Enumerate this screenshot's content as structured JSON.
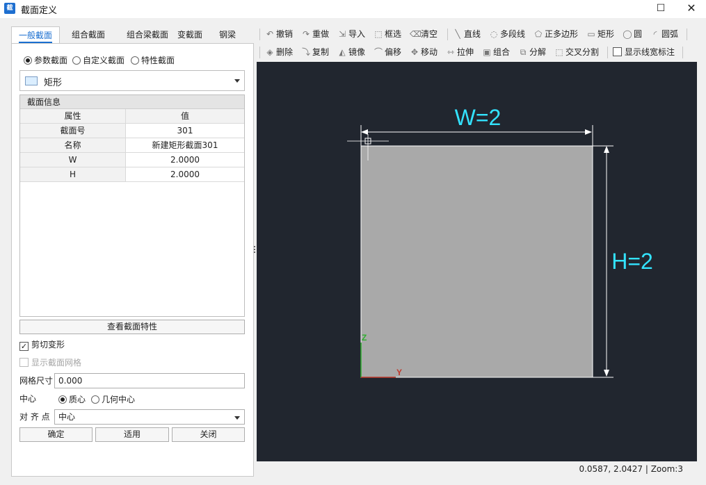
{
  "window": {
    "title": "截面定义",
    "max_glyph": "☐",
    "close_glyph": "✕",
    "app_icon_text": "截"
  },
  "tabs": [
    {
      "label": "一般截面",
      "active": true
    },
    {
      "label": "组合截面"
    },
    {
      "label": "组合梁截面"
    },
    {
      "label": "变截面"
    },
    {
      "label": "钢梁"
    }
  ],
  "section_type": {
    "options": [
      "参数截面",
      "自定义截面",
      "特性截面"
    ],
    "selected": "参数截面"
  },
  "shape": {
    "label": "矩形"
  },
  "section_info": {
    "title": "截面信息",
    "columns": [
      "属性",
      "值"
    ],
    "rows": [
      {
        "name": "截面号",
        "value": "301"
      },
      {
        "name": "名称",
        "value": "新建矩形截面301"
      },
      {
        "name": "W",
        "value": "2.0000"
      },
      {
        "name": "H",
        "value": "2.0000"
      }
    ]
  },
  "view_props_button": "查看截面特性",
  "shear_deform": {
    "label": "剪切变形",
    "checked": true
  },
  "show_mesh": {
    "label": "显示截面网格",
    "checked": false,
    "enabled": false
  },
  "mesh_size": {
    "label": "网格尺寸",
    "value": "0.000"
  },
  "center": {
    "label": "中心",
    "options": [
      "质心",
      "几何中心"
    ],
    "selected": "质心"
  },
  "align_point": {
    "label": "对 齐 点",
    "value": "中心"
  },
  "buttons": {
    "ok": "确定",
    "apply": "适用",
    "close": "关闭"
  },
  "toolbar": {
    "row1": [
      {
        "label": "撤销",
        "icon": "undo-icon",
        "glyph": "↶"
      },
      {
        "label": "重做",
        "icon": "redo-icon",
        "glyph": "↷"
      },
      {
        "label": "导入",
        "icon": "import-icon",
        "glyph": "⇲"
      },
      {
        "label": "框选",
        "icon": "box-select-icon",
        "glyph": "⬚"
      },
      {
        "label": "清空",
        "icon": "clear-icon",
        "glyph": "⌫"
      },
      {
        "label": "直线",
        "icon": "line-icon",
        "glyph": "╲"
      },
      {
        "label": "多段线",
        "icon": "polyline-icon",
        "glyph": "◌"
      },
      {
        "label": "正多边形",
        "icon": "polygon-icon",
        "glyph": "⬠"
      },
      {
        "label": "矩形",
        "icon": "rectangle-icon",
        "glyph": "▭"
      },
      {
        "label": "圆",
        "icon": "circle-icon",
        "glyph": "◯"
      },
      {
        "label": "圆弧",
        "icon": "arc-icon",
        "glyph": "◜"
      }
    ],
    "row2": [
      {
        "label": "删除",
        "icon": "delete-icon",
        "glyph": "◈"
      },
      {
        "label": "复制",
        "icon": "copy-icon",
        "glyph": "⤵"
      },
      {
        "label": "镜像",
        "icon": "mirror-icon",
        "glyph": "◭"
      },
      {
        "label": "偏移",
        "icon": "offset-icon",
        "glyph": "⌒"
      },
      {
        "label": "移动",
        "icon": "move-icon",
        "glyph": "✥"
      },
      {
        "label": "拉伸",
        "icon": "stretch-icon",
        "glyph": "⇿"
      },
      {
        "label": "组合",
        "icon": "group-icon",
        "glyph": "▣"
      },
      {
        "label": "分解",
        "icon": "explode-icon",
        "glyph": "⧉"
      },
      {
        "label": "交叉分割",
        "icon": "cross-split-icon",
        "glyph": "⬚"
      }
    ],
    "show_width_label": {
      "label": "显示线宽标注",
      "checked": false
    }
  },
  "canvas": {
    "width_label": "W=2",
    "height_label": "H=2",
    "axis_z": "Z",
    "axis_y": "Y",
    "colors": {
      "background": "#21262f",
      "section_fill": "#a9a9a9",
      "dimension": "#ffffff",
      "dim_text": "#33e3ff",
      "axis_z": "#2fae2f",
      "axis_y": "#c0392b"
    }
  },
  "status": {
    "text": "0.0587, 2.0427 | Zoom:3"
  }
}
